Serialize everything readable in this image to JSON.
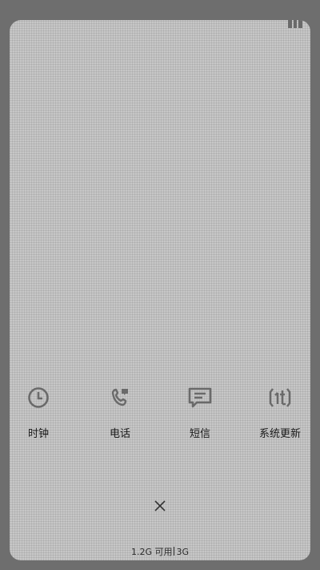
{
  "recent_apps": [
    {
      "label": "时钟",
      "icon": "clock-icon"
    },
    {
      "label": "电话",
      "icon": "phone-icon"
    },
    {
      "label": "短信",
      "icon": "message-icon"
    },
    {
      "label": "系统更新",
      "icon": "system-update-icon"
    }
  ],
  "memory": {
    "available": "1.2G 可用",
    "total": "3G"
  },
  "colors": {
    "icon": "#6a6a6a",
    "text": "#1a1a1a",
    "screen": "#c7c7c7"
  }
}
